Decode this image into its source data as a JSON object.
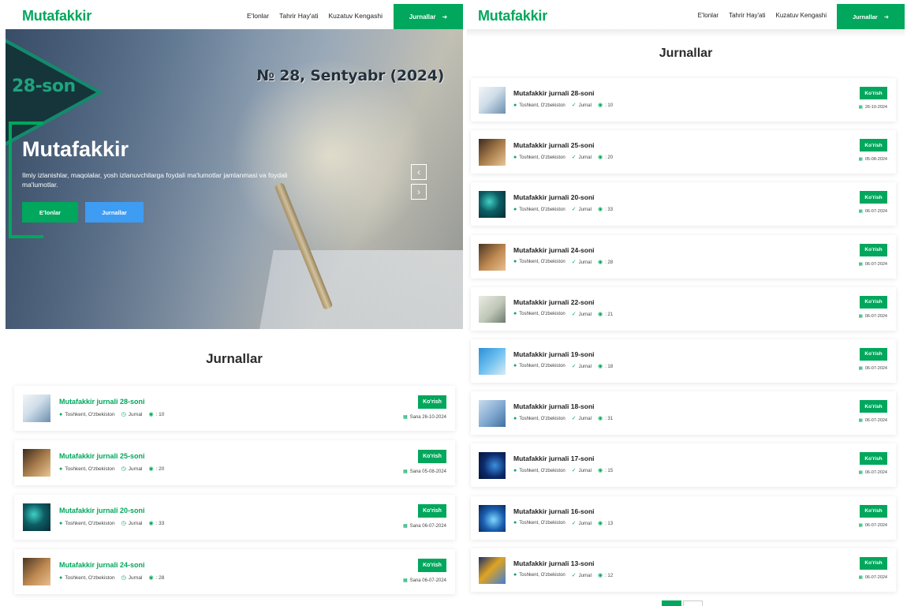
{
  "brand": "Mutafakkir",
  "nav": {
    "links": [
      "E'lonlar",
      "Tahrir Hay'ati",
      "Kuzatuv Kengashi"
    ],
    "cta_label": "Jurnallar",
    "cta_icon": "arrow-right-icon"
  },
  "hero": {
    "badge_text": "28-son",
    "issue_text": "№ 28, Sentyabr (2024)",
    "title": "Mutafakkir",
    "description": "Ilmiy izlanishlar, maqolalar, yosh izlanuvchilarga foydali ma'lumotlar jamlanmasi va foydali ma'lumotlar.",
    "btn_primary": "E'lonlar",
    "btn_secondary": "Jurnallar",
    "prev_icon": "chevron-left-icon",
    "next_icon": "chevron-right-icon"
  },
  "section_title": "Jurnallar",
  "labels": {
    "view": "Ko'rish",
    "location": "Toshkent, O'zbekiston",
    "type": "Jurnal",
    "date_prefix": "Sana"
  },
  "left_journals": [
    {
      "title": "Mutafakkir jurnali 28-soni",
      "views": ": 10",
      "date": "Sana 26-10-2024"
    },
    {
      "title": "Mutafakkir jurnali 25-soni",
      "views": ": 20",
      "date": "Sana 05-08-2024"
    },
    {
      "title": "Mutafakkir jurnali 20-soni",
      "views": ": 33",
      "date": "Sana 06-07-2024"
    },
    {
      "title": "Mutafakkir jurnali 24-soni",
      "views": ": 28",
      "date": "Sana 06-07-2024"
    }
  ],
  "right_journals": [
    {
      "title": "Mutafakkir jurnali 28-soni",
      "views": ": 10",
      "date": "26-10-2024"
    },
    {
      "title": "Mutafakkir jurnali 25-soni",
      "views": ": 20",
      "date": "05-08-2024"
    },
    {
      "title": "Mutafakkir jurnali 20-soni",
      "views": ": 33",
      "date": "06-07-2024"
    },
    {
      "title": "Mutafakkir jurnali 24-soni",
      "views": ": 28",
      "date": "06-07-2024"
    },
    {
      "title": "Mutafakkir jurnali 22-soni",
      "views": ": 21",
      "date": "06-07-2024"
    },
    {
      "title": "Mutafakkir jurnali 19-soni",
      "views": ": 18",
      "date": "06-07-2024"
    },
    {
      "title": "Mutafakkir jurnali 18-soni",
      "views": ": 31",
      "date": "06-07-2024"
    },
    {
      "title": "Mutafakkir jurnali 17-soni",
      "views": ": 15",
      "date": "06-07-2024"
    },
    {
      "title": "Mutafakkir jurnali 16-soni",
      "views": ": 13",
      "date": "06-07-2024"
    },
    {
      "title": "Mutafakkir jurnali 13-soni",
      "views": ": 12",
      "date": "06-07-2024"
    }
  ],
  "colors": {
    "brand_green": "#00a75c",
    "accent_blue": "#3e9cf3",
    "hero_triangle": "#15353b"
  }
}
